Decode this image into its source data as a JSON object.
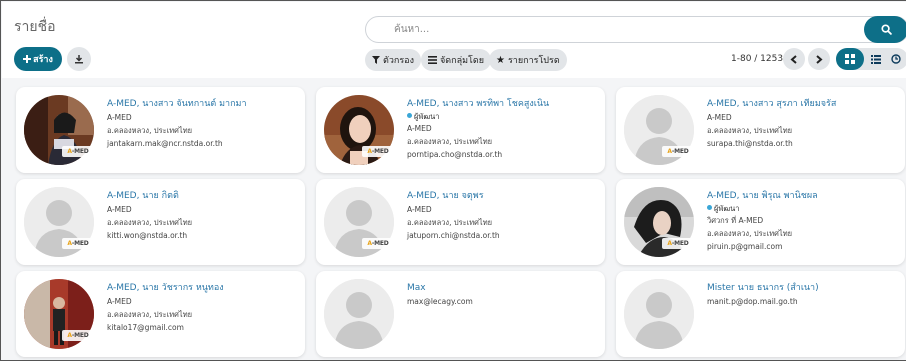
{
  "control_panel": {
    "title": "รายชื่อ",
    "search_placeholder": "ค้นหา...",
    "create_label": "สร้าง",
    "filters_label": "ตัวกรอง",
    "group_by_label": "จัดกลุ่มโดย",
    "favorites_label": "รายการโปรด",
    "pager_text": "1-80 / 1253"
  },
  "colors": {
    "accent": "#0d6f88",
    "link": "#2b77a8",
    "tag_dot": "#3aa6d6"
  },
  "cards": [
    {
      "name": "A-MED, นางสาว จันทกานต์ มากมา",
      "tag": "",
      "company": "A-MED",
      "address": "อ.คลองหลวง, ประเทศไทย",
      "email": "jantakarn.mak@ncr.nstda.or.th",
      "avatar": "photo",
      "logo": "A-MED"
    },
    {
      "name": "A-MED, นางสาว พรทิพา โชคสูงเนิน",
      "tag": "ผู้พัฒนา",
      "company": "A-MED",
      "address": "อ.คลองหลวง, ประเทศไทย",
      "email": "porntipa.cho@nstda.or.th",
      "avatar": "photo",
      "logo": "A-MED"
    },
    {
      "name": "A-MED, นางสาว สุรภา เทียมจรัส",
      "tag": "",
      "company": "A-MED",
      "address": "อ.คลองหลวง, ประเทศไทย",
      "email": "surapa.thi@nstda.or.th",
      "avatar": "placeholder",
      "logo": "A-MED"
    },
    {
      "name": "A-MED, นาย กิตติ",
      "tag": "",
      "company": "A-MED",
      "address": "อ.คลองหลวง, ประเทศไทย",
      "email": "kitti.won@nstda.or.th",
      "avatar": "placeholder",
      "logo": "A-MED"
    },
    {
      "name": "A-MED, นาย จตุพร",
      "tag": "",
      "company": "A-MED",
      "address": "อ.คลองหลวง, ประเทศไทย",
      "email": "jatuporn.chi@nstda.or.th",
      "avatar": "placeholder",
      "logo": "A-MED"
    },
    {
      "name": "A-MED, นาย พิรุณ พานิชผล",
      "tag": "ผู้พัฒนา",
      "company": "วิศวกร ที่ A-MED",
      "address": "อ.คลองหลวง, ประเทศไทย",
      "email": "piruin.p@gmail.com",
      "avatar": "photo",
      "logo": "A-MED"
    },
    {
      "name": "A-MED, นาย วัชรากร หนูทอง",
      "tag": "",
      "company": "A-MED",
      "address": "อ.คลองหลวง, ประเทศไทย",
      "email": "kitalo17@gmail.com",
      "avatar": "photo",
      "logo": "A-MED"
    },
    {
      "name": "Max",
      "tag": "",
      "company": "",
      "address": "",
      "email": "max@lecagy.com",
      "avatar": "placeholder",
      "logo": ""
    },
    {
      "name": "Mister นาย ธนากร (สำเนา)",
      "tag": "",
      "company": "",
      "address": "",
      "email": "manit.p@dop.mail.go.th",
      "avatar": "placeholder",
      "logo": ""
    }
  ]
}
